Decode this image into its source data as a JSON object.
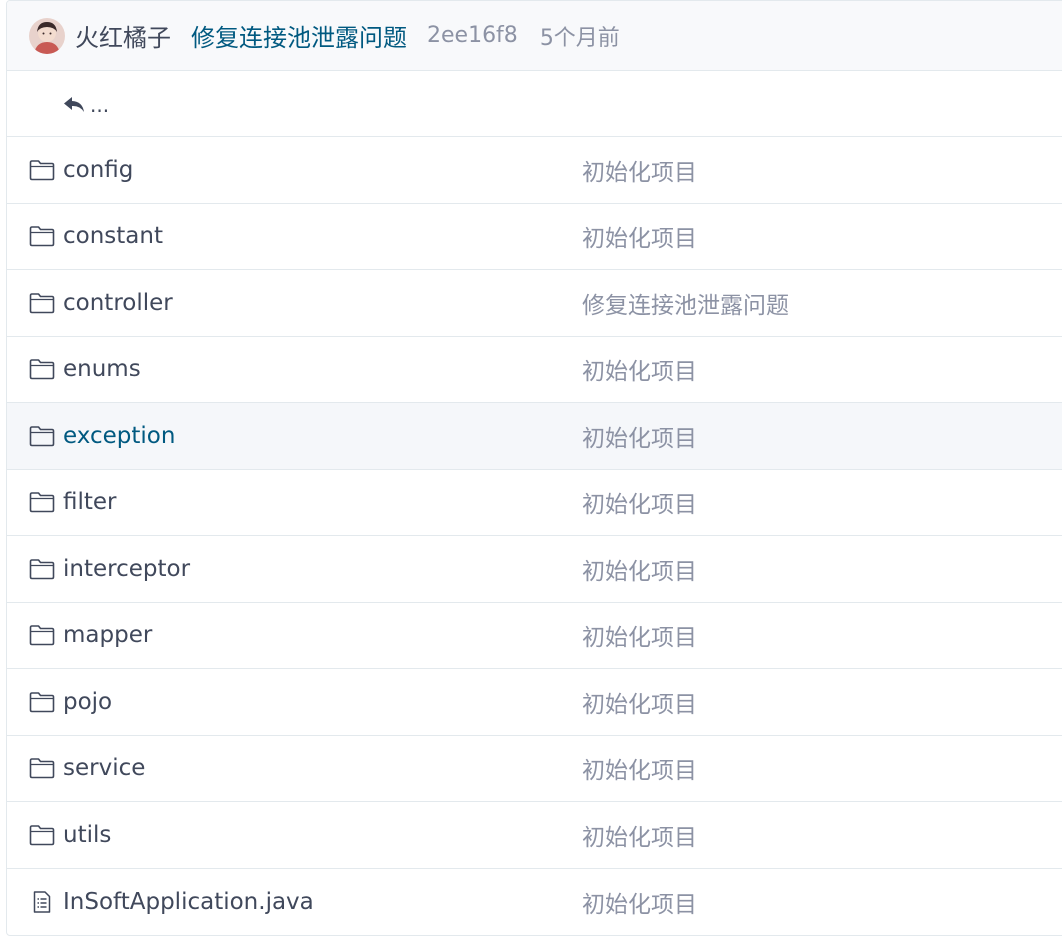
{
  "latest_commit": {
    "author": "火红橘子",
    "message": "修复连接池泄露问题",
    "sha": "2ee16f8",
    "time": "5个月前"
  },
  "parent_directory": {
    "label": "..."
  },
  "files": [
    {
      "name": "config",
      "type": "folder",
      "commit_message": "初始化项目"
    },
    {
      "name": "constant",
      "type": "folder",
      "commit_message": "初始化项目"
    },
    {
      "name": "controller",
      "type": "folder",
      "commit_message": "修复连接池泄露问题"
    },
    {
      "name": "enums",
      "type": "folder",
      "commit_message": "初始化项目"
    },
    {
      "name": "exception",
      "type": "folder",
      "commit_message": "初始化项目"
    },
    {
      "name": "filter",
      "type": "folder",
      "commit_message": "初始化项目"
    },
    {
      "name": "interceptor",
      "type": "folder",
      "commit_message": "初始化项目"
    },
    {
      "name": "mapper",
      "type": "folder",
      "commit_message": "初始化项目"
    },
    {
      "name": "pojo",
      "type": "folder",
      "commit_message": "初始化项目"
    },
    {
      "name": "service",
      "type": "folder",
      "commit_message": "初始化项目"
    },
    {
      "name": "utils",
      "type": "folder",
      "commit_message": "初始化项目"
    },
    {
      "name": "InSoftApplication.java",
      "type": "file",
      "commit_message": "初始化项目"
    }
  ],
  "hovered_row": "exception",
  "colors": {
    "link": "#005980",
    "text": "#40485b",
    "muted": "#8c92a4",
    "border": "#e3e9ed",
    "header_bg": "#f8f9fb",
    "hover_bg": "#f5f7fa"
  }
}
